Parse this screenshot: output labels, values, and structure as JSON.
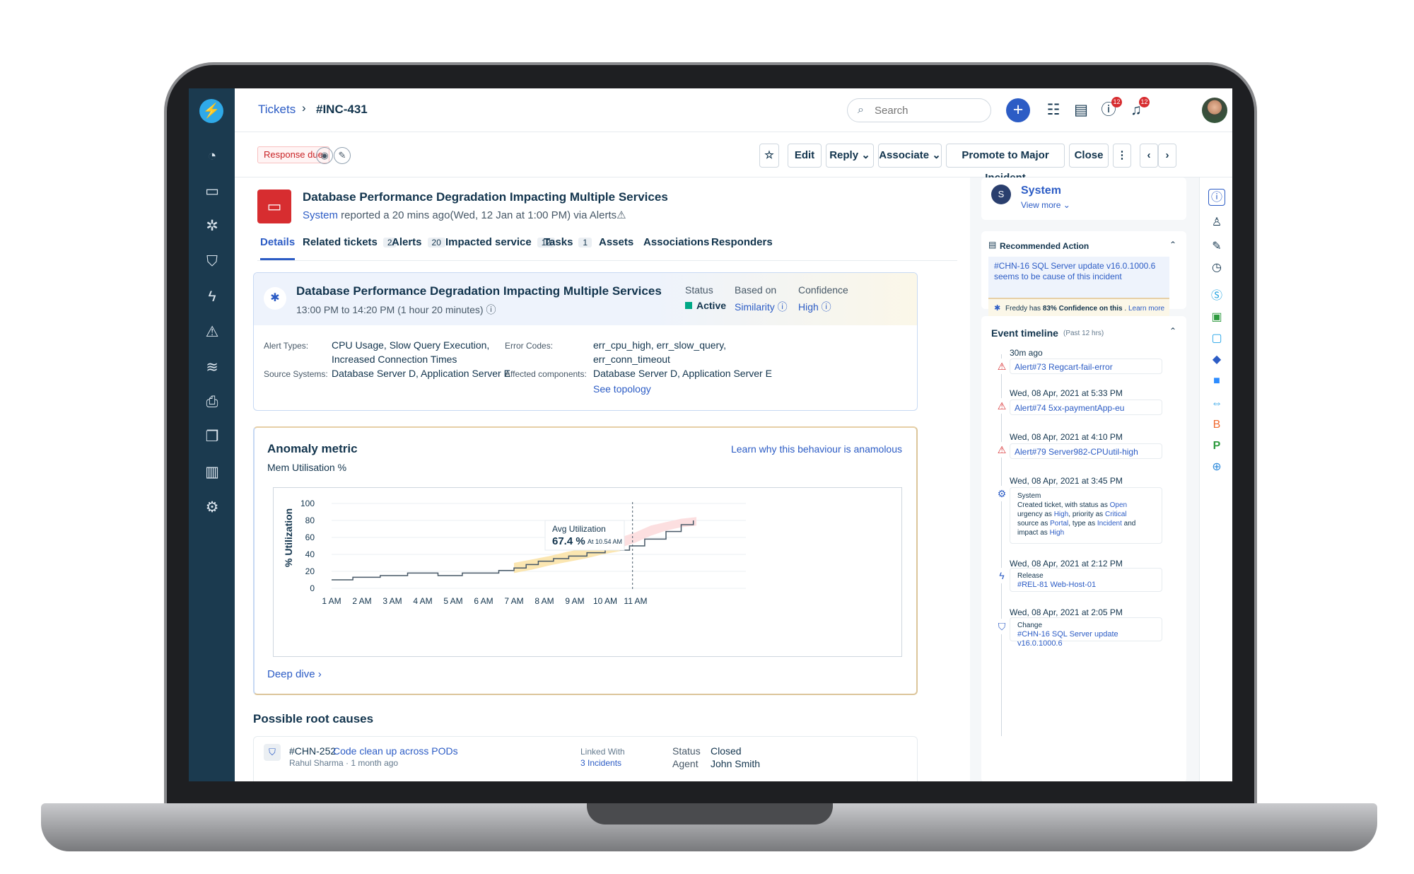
{
  "header": {
    "breadcrumb_link": "Tickets",
    "breadcrumb_sep": "›",
    "ticket_id": "#INC-431",
    "search_placeholder": "Search",
    "help_badge": "12",
    "notif_badge": "12"
  },
  "toolbar": {
    "response_badge": "Response due",
    "edit": "Edit",
    "reply": "Reply ⌄",
    "associate": "Associate ⌄",
    "promote": "Promote to Major Incident",
    "close": "Close",
    "more": "⋮",
    "prev": "‹",
    "next": "›"
  },
  "ticket": {
    "title": "Database Performance Degradation Impacting Multiple Services",
    "reporter": "System",
    "reported_text": " reported a 20 mins ago(Wed, 12 Jan at 1:00 PM) via Alerts",
    "alert_glyph": "⚠"
  },
  "tabs": [
    {
      "label": "Details"
    },
    {
      "label": "Related tickets",
      "count": "2"
    },
    {
      "label": "Alerts",
      "count": "20"
    },
    {
      "label": "Impacted service",
      "count": "12"
    },
    {
      "label": "Tasks",
      "count": "1"
    },
    {
      "label": "Assets"
    },
    {
      "label": "Associations"
    },
    {
      "label": "Responders"
    }
  ],
  "incident": {
    "title": "Database Performance Degradation Impacting Multiple Services",
    "time_range": "13:00 PM to 14:20 PM (1 hour 20 minutes) ⓘ",
    "status_label": "Status",
    "status_value": "Active",
    "based_label": "Based on",
    "based_value": "Similarity ⓘ",
    "confidence_label": "Confidence",
    "confidence_value": "High ⓘ",
    "alert_types_label": "Alert Types:",
    "alert_types_line1": "CPU Usage, Slow Query Execution,",
    "alert_types_line2": "Increased Connection Times",
    "error_codes_label": "Error Codes:",
    "error_codes_line1": "err_cpu_high, err_slow_query,",
    "error_codes_line2": "err_conn_timeout",
    "source_label": "Source Systems:",
    "source_value": "Database Server D, Application Server E",
    "affected_label": "Affected components:",
    "affected_value": "Database Server D, Application Server E",
    "see_topology": "See topology"
  },
  "anomaly": {
    "title": "Anomaly metric",
    "subtitle": "Mem Utilisation %",
    "learn_link": "Learn why this behaviour is anamolous",
    "deep_dive": "Deep dive ›",
    "tooltip_title": "Avg Utilization",
    "tooltip_value": "67.4 %",
    "tooltip_time": "At 10.54 AM"
  },
  "chart_data": {
    "type": "line",
    "ylabel": "% Utilization",
    "xlabel": "",
    "ylim": [
      0,
      100
    ],
    "yticks": [
      0,
      20,
      40,
      60,
      80,
      100
    ],
    "categories": [
      "1 AM",
      "2 AM",
      "3 AM",
      "4 AM",
      "5 AM",
      "6 AM",
      "7 AM",
      "8 AM",
      "9 AM",
      "10 AM",
      "11 AM"
    ],
    "x": [
      1,
      1.5,
      1.7,
      2.3,
      2.6,
      3.2,
      3.5,
      4.1,
      4.5,
      5.3,
      6,
      6.5,
      7,
      7.4,
      7.8,
      8.3,
      8.8,
      9.4,
      10,
      10.5,
      10.8,
      11.3,
      12,
      12.5,
      12.9
    ],
    "values": [
      10,
      10,
      13,
      13,
      15,
      15,
      18,
      18,
      15,
      18,
      18,
      21,
      24,
      28,
      32,
      35,
      38,
      42,
      46,
      45,
      50,
      58,
      67,
      75,
      80
    ],
    "bands": [
      {
        "name": "warning",
        "x": [
          7.0,
          10.5
        ],
        "low": [
          18,
          22,
          27,
          31,
          35,
          40,
          44
        ],
        "high": [
          30,
          34,
          38,
          43,
          47,
          50,
          54
        ]
      },
      {
        "name": "critical",
        "x": [
          10.0,
          13.0
        ],
        "low": [
          44,
          48,
          54,
          62,
          68,
          72,
          74
        ],
        "high": [
          56,
          60,
          66,
          74,
          78,
          82,
          84
        ]
      }
    ],
    "marker_x": 10.9
  },
  "root_causes": {
    "title": "Possible root causes",
    "item_id": "#CHN-252",
    "item_title": "Code clean up across PODs",
    "item_meta": "Rahul Sharma · 1 month ago",
    "linked_label": "Linked With",
    "linked_value": "3 Incidents",
    "status_label": "Status",
    "status_value": "Closed",
    "agent_label": "Agent",
    "agent_value": "John Smith"
  },
  "requester": {
    "initial": "S",
    "name": "System",
    "view_more": "View more ⌄"
  },
  "recommended": {
    "title": "Recommended Action",
    "text": "#CHN-16 SQL Server update v16.0.1000.6 seems to be cause of this incident",
    "freddy_prefix": "Freddy has ",
    "freddy_pct": "83% Confidence on this",
    "freddy_mid": " . ",
    "learn_more": "Learn more"
  },
  "timeline": {
    "title": "Event timeline",
    "subtitle": "(Past 12 hrs)",
    "events": [
      {
        "date": "30m ago",
        "text": "Alert#73 Regcart-fail-error"
      },
      {
        "date": "Wed, 08 Apr, 2021 at 5:33 PM",
        "text": "Alert#74 5xx-paymentApp-eu"
      },
      {
        "date": "Wed, 08 Apr, 2021 at 4:10 PM",
        "text": "Alert#79 Server982-CPUutil-high"
      },
      {
        "date": "Wed, 08 Apr, 2021 at 3:45 PM",
        "title": "System",
        "l1": "Created ticket, with status as ",
        "v1": "Open",
        "l2": "urgency as ",
        "v2": "High",
        "l3": ", priority as ",
        "v3": "Critical",
        "l4": "source as ",
        "v4": "Portal",
        "l5": ", type as ",
        "v5": "Incident",
        "l6": " and",
        "l7": "impact as ",
        "v7": "High"
      },
      {
        "date": "Wed, 08 Apr, 2021 at 2:12 PM",
        "title": "Release",
        "text": "#REL-81 Web-Host-01"
      },
      {
        "date": "Wed, 08 Apr, 2021 at 2:05 PM",
        "title": "Change",
        "text": "#CHN-16 SQL Server update v16.0.1000.6"
      }
    ]
  },
  "colors": {
    "sidebar": "#1b3a4f",
    "accent": "#2c5cc5",
    "danger": "#d72d30",
    "warning_band": "#fbe3a8",
    "critical_band": "#fcdcdd"
  }
}
